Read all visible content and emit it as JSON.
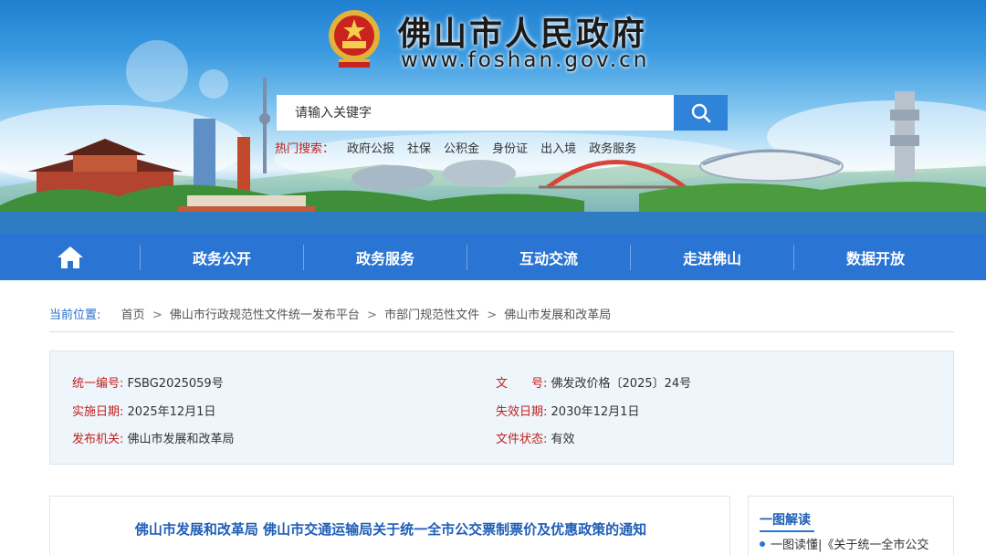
{
  "header": {
    "title": "佛山市人民政府",
    "domain": "www.foshan.gov.cn"
  },
  "search": {
    "placeholder": "请输入关键字",
    "hot_label": "热门搜索：",
    "hot_items": [
      "政府公报",
      "社保",
      "公积金",
      "身份证",
      "出入境",
      "政务服务"
    ]
  },
  "nav": {
    "items": [
      "政务公开",
      "政务服务",
      "互动交流",
      "走进佛山",
      "数据开放"
    ]
  },
  "breadcrumb": {
    "label": "当前位置:",
    "items": [
      "首页",
      "佛山市行政规范性文件统一发布平台",
      "市部门规范性文件",
      "佛山市发展和改革局"
    ],
    "separator": ">"
  },
  "info": {
    "serial_label": "统一编号:",
    "serial_value": "FSBG2025059号",
    "doc_label": "文　　号:",
    "doc_value": "佛发改价格〔2025〕24号",
    "effective_label": "实施日期:",
    "effective_value": "2025年12月1日",
    "expire_label": "失效日期:",
    "expire_value": "2030年12月1日",
    "issuer_label": "发布机关:",
    "issuer_value": "佛山市发展和改革局",
    "status_label": "文件状态:",
    "status_value": "有效"
  },
  "article": {
    "title": "佛山市发展和改革局 佛山市交通运输局关于统一全市公交票制票价及优惠政策的通知"
  },
  "sidebar": {
    "heading": "一图解读",
    "item": "一图读懂|《关于统一全市公交"
  },
  "colors": {
    "nav_blue": "#2a75d3",
    "label_red": "#c4201c",
    "title_blue": "#1f5eb8"
  }
}
